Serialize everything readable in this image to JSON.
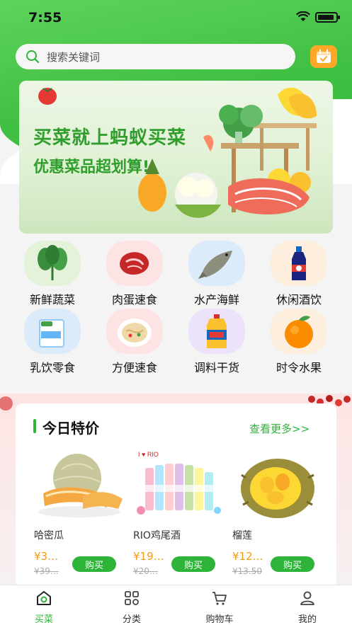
{
  "status": {
    "time": "7:55"
  },
  "search": {
    "placeholder": "搜索关键词"
  },
  "banner": {
    "line1": "买菜就上蚂蚁买菜",
    "line2": "优惠菜品超划算!"
  },
  "categories": [
    {
      "label": "新鲜蔬菜",
      "icon": "vegetable-icon",
      "color": "#e4f2d9"
    },
    {
      "label": "肉蛋速食",
      "icon": "meat-icon",
      "color": "#fde3e3"
    },
    {
      "label": "水产海鲜",
      "icon": "fish-icon",
      "color": "#dcebfa"
    },
    {
      "label": "休闲酒饮",
      "icon": "drink-icon",
      "color": "#fdeedd"
    },
    {
      "label": "乳饮零食",
      "icon": "milk-icon",
      "color": "#dcebfa"
    },
    {
      "label": "方便速食",
      "icon": "noodle-icon",
      "color": "#fde3e3"
    },
    {
      "label": "调料干货",
      "icon": "oil-icon",
      "color": "#ece2f9"
    },
    {
      "label": "时令水果",
      "icon": "orange-icon",
      "color": "#fdeedd"
    }
  ],
  "promo": {
    "title": "今日特价",
    "more": "查看更多>>",
    "products": [
      {
        "name": "哈密瓜",
        "price": "¥3…",
        "old_price": "¥39…",
        "buy": "购买"
      },
      {
        "name": "RIO鸡尾酒",
        "price": "¥19…",
        "old_price": "¥20…",
        "buy": "购买"
      },
      {
        "name": "榴莲",
        "price": "¥12…",
        "old_price": "¥13.50",
        "buy": "购买"
      }
    ]
  },
  "tabs": [
    {
      "label": "买菜",
      "icon": "home-icon",
      "active": true
    },
    {
      "label": "分类",
      "icon": "category-icon",
      "active": false
    },
    {
      "label": "购物车",
      "icon": "cart-icon",
      "active": false
    },
    {
      "label": "我的",
      "icon": "user-icon",
      "active": false
    }
  ],
  "colors": {
    "primary": "#2fb43a",
    "price": "#f39c12",
    "accent": "#ffa726"
  }
}
